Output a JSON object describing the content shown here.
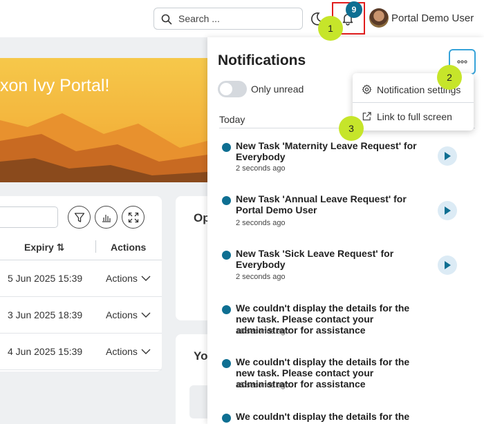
{
  "header": {
    "search_placeholder": "Search ...",
    "notification_count": "9",
    "user_name": "Portal Demo User"
  },
  "banner": {
    "text": "xon Ivy Portal!"
  },
  "task_table": {
    "columns": {
      "expiry": "Expiry",
      "expiry_sort_icon": "⇅",
      "actions": "Actions"
    },
    "rows": [
      {
        "expiry": "5 Jun 2025 15:39",
        "action": "Actions"
      },
      {
        "expiry": "3 Jun 2025 18:39",
        "action": "Actions"
      },
      {
        "expiry": "4 Jun 2025 15:39",
        "action": "Actions"
      }
    ]
  },
  "side_cards": {
    "card1_title": "Op",
    "card2_title": "Yo"
  },
  "notifications": {
    "title": "Notifications",
    "only_unread_label": "Only unread",
    "group_label": "Today",
    "items": [
      {
        "text": "New Task 'Maternity Leave Request' for Everybody",
        "time": "2 seconds ago",
        "has_action": true
      },
      {
        "text": "New Task 'Annual Leave Request' for Portal Demo User",
        "time": "2 seconds ago",
        "has_action": true
      },
      {
        "text": "New Task 'Sick Leave Request' for Everybody",
        "time": "2 seconds ago",
        "has_action": true
      },
      {
        "text": "We couldn't display the details for the new task. Please contact your administrator for assistance",
        "time": "10 seconds ago",
        "has_action": false
      },
      {
        "text": "We couldn't display the details for the new task. Please contact your administrator for assistance",
        "time": "15 seconds ago",
        "has_action": false
      },
      {
        "text": "We couldn't display the details for the new task. Please contact your administrator for assistance",
        "time": "",
        "has_action": false
      }
    ]
  },
  "menu": {
    "settings_label": "Notification settings",
    "fullscreen_label": "Link to full screen"
  },
  "markers": [
    "1",
    "2",
    "3"
  ],
  "colors": {
    "accent": "#0e6f92",
    "marker": "#c6e52a",
    "highlight_border": "#e11d1d"
  }
}
